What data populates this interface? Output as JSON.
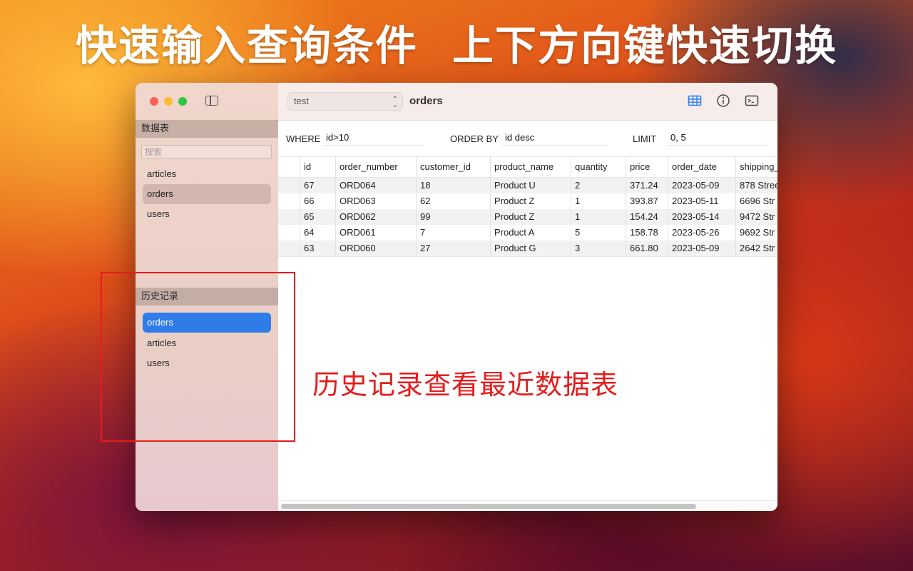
{
  "banner": {
    "left": "快速输入查询条件",
    "right": "上下方向键快速切换"
  },
  "sidebar": {
    "tables_header": "数据表",
    "search_placeholder": "搜索",
    "tables": [
      {
        "label": "articles",
        "selected": false
      },
      {
        "label": "orders",
        "selected": true
      },
      {
        "label": "users",
        "selected": false
      }
    ],
    "history_header": "历史记录",
    "history": [
      {
        "label": "orders",
        "selected": true
      },
      {
        "label": "articles",
        "selected": false
      },
      {
        "label": "users",
        "selected": false
      }
    ]
  },
  "toolbar": {
    "database": "test",
    "table_title": "orders",
    "icons": [
      "table-view-icon",
      "info-icon",
      "terminal-icon"
    ]
  },
  "filters": {
    "where_label": "WHERE",
    "where_value": "id>10",
    "order_label": "ORDER BY",
    "order_value": "id desc",
    "limit_label": "LIMIT",
    "limit_value": "0, 5"
  },
  "grid": {
    "columns": [
      "id",
      "order_number",
      "customer_id",
      "product_name",
      "quantity",
      "price",
      "order_date",
      "shipping_"
    ],
    "rows": [
      [
        "67",
        "ORD064",
        "18",
        "Product U",
        "2",
        "371.24",
        "2023-05-09",
        "878 Stree"
      ],
      [
        "66",
        "ORD063",
        "62",
        "Product Z",
        "1",
        "393.87",
        "2023-05-11",
        "6696 Str"
      ],
      [
        "65",
        "ORD062",
        "99",
        "Product Z",
        "1",
        "154.24",
        "2023-05-14",
        "9472 Str"
      ],
      [
        "64",
        "ORD061",
        "7",
        "Product A",
        "5",
        "158.78",
        "2023-05-26",
        "9692 Str"
      ],
      [
        "63",
        "ORD060",
        "27",
        "Product G",
        "3",
        "661.80",
        "2023-05-09",
        "2642 Str"
      ]
    ]
  },
  "annotation": {
    "text": "历史记录查看最近数据表",
    "color": "#e51d1d"
  },
  "colors": {
    "accent_blue": "#2f7ce9",
    "toolbar_icon_blue": "#2f7ce9"
  }
}
